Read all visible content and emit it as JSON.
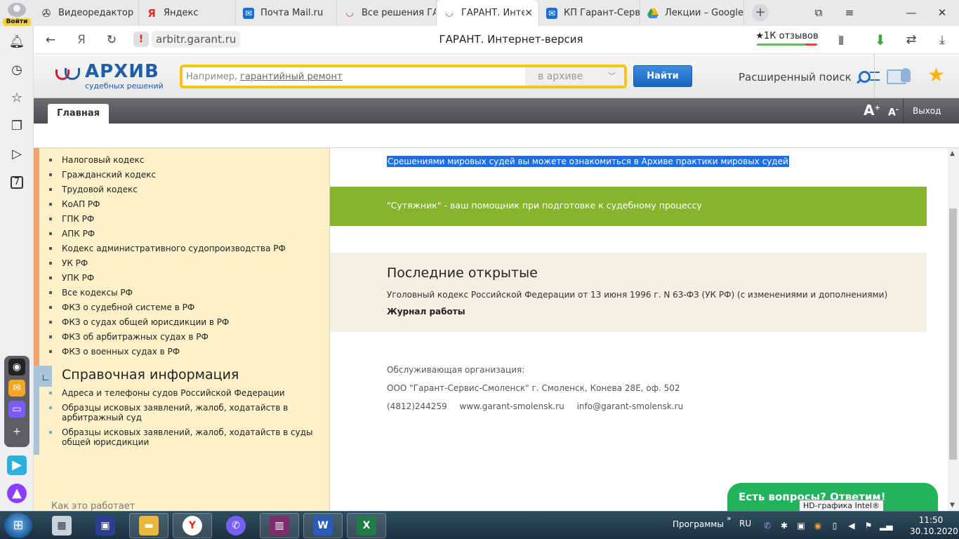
{
  "browser": {
    "login_label": "Войти",
    "tabs": [
      {
        "label": "Видеоредактор",
        "icon": "film-icon"
      },
      {
        "label": "Яндекс",
        "icon": "yandex-icon"
      },
      {
        "label": "Почта Mail.ru",
        "icon": "mail-icon"
      },
      {
        "label": "Все решения ГАРАНТ",
        "icon": "garant-icon"
      },
      {
        "label": "ГАРАНТ. Интернет-версия",
        "icon": "garant-icon",
        "active": true
      },
      {
        "label": "КП Гарант-Сервис",
        "icon": "mail-icon"
      },
      {
        "label": "Лекции – Google Диск",
        "icon": "google-drive-icon"
      }
    ],
    "new_tab": "+",
    "url_host": "arbitr.garant.ru",
    "page_title": "ГАРАНТ. Интернет-версия",
    "reviews_label": "★1К отзывов"
  },
  "header": {
    "logo_title": "АРХИВ",
    "logo_subtitle": "судебных решений",
    "search_placeholder_prefix": "Например,",
    "search_placeholder_sample": "гарантийный ремонт",
    "search_scope": "в архиве",
    "search_button": "Найти",
    "advanced_search": "Расширенный поиск"
  },
  "nav": {
    "main_tab": "Главная",
    "font_increase": "A",
    "font_increase_sup": "+",
    "font_decrease": "A",
    "font_decrease_sup": "-",
    "logout": "Выход"
  },
  "left": {
    "codes": [
      "Налоговый кодекс",
      "Гражданский кодекс",
      "Трудовой кодекс",
      "КоАП РФ",
      "ГПК РФ",
      "АПК РФ",
      "Кодекс административного судопроизводства РФ",
      "УК РФ",
      "УПК РФ",
      "Все кодексы РФ",
      "ФКЗ о судебной системе в РФ",
      "ФКЗ о судах общей юрисдикции в РФ",
      "ФКЗ об арбитражных судах в РФ",
      "ФКЗ о военных судах в РФ"
    ],
    "info_title": "Справочная информация",
    "info_items": [
      "Адреса и телефоны судов Российской Федерации",
      "Образцы исковых заявлений, жалоб, ходатайств в арбитражный суд",
      "Образцы исковых заявлений, жалоб, ходатайств в суды общей юрисдикции"
    ],
    "how_it_works": "Как это работает"
  },
  "right": {
    "magistrate_link": "Срешениями мировых судей вы можете ознакомиться в Архиве практики мировых судей",
    "sutyazhnik": "\"Сутяжник\" - ваш помощник при подготовке к судебному процессу",
    "recent_title": "Последние открытые",
    "recent_doc": "Уголовный кодекс Российской Федерации от 13 июня 1996 г. N 63-ФЗ (УК РФ) (с изменениями и дополнениями)",
    "journal": "Журнал работы",
    "org_label": "Обслуживающая организация:",
    "org_name": "ООО \"Гарант-Сервис-Смоленск\" г. Смоленск, Конева 28Е, оф. 502",
    "org_phone": "(4812)244259",
    "org_site": "www.garant-smolensk.ru",
    "org_email": "info@garant-smolensk.ru"
  },
  "chat": {
    "label": "Есть вопросы? Ответим!"
  },
  "tooltip": "HD-графика Intel®",
  "taskbar": {
    "programs_label": "Программы",
    "lang": "RU",
    "time": "11:50",
    "date": "30.10.2020"
  },
  "colors": {
    "accent_blue": "#1e5da8",
    "search_border": "#f6c711",
    "green_band": "#86b52d",
    "chat_green": "#21b45d",
    "left_panel_bg": "#fdf1c9"
  }
}
